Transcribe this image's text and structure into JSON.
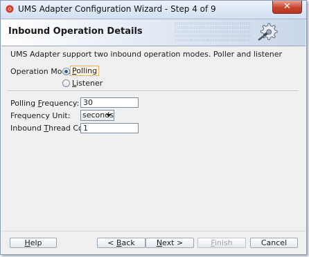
{
  "window": {
    "title": "UMS Adapter Configuration Wizard - Step 4 of 9",
    "close_label": "✕"
  },
  "header": {
    "title": "Inbound Operation Details"
  },
  "description": "UMS Adapter support two inbound operation modes. Poller and listener",
  "operation_mode": {
    "label": "Operation Mode:",
    "options": [
      {
        "label_prefix": "",
        "mnemonic": "P",
        "label_rest": "olling",
        "selected": true
      },
      {
        "label_prefix": "",
        "mnemonic": "L",
        "label_rest": "istener",
        "selected": false
      }
    ]
  },
  "fields": {
    "polling_frequency": {
      "label_prefix": "Polling ",
      "mnemonic": "F",
      "label_rest": "requency:",
      "value": "30"
    },
    "frequency_unit": {
      "label": "Frequency Unit:",
      "value": "seconds"
    },
    "inbound_thread_count": {
      "label_prefix": "Inbound ",
      "mnemonic": "T",
      "label_rest": "hread Count:",
      "value": "1"
    }
  },
  "buttons": {
    "help": {
      "prefix": "",
      "mnemonic": "H",
      "rest": "elp"
    },
    "back": {
      "prefix": "< ",
      "mnemonic": "B",
      "rest": "ack"
    },
    "next": {
      "prefix": "",
      "mnemonic": "N",
      "rest": "ext >"
    },
    "finish": {
      "prefix": "",
      "mnemonic": "F",
      "rest": "inish",
      "enabled": false
    },
    "cancel": {
      "label": "Cancel"
    }
  },
  "icons": {
    "app": "oracle-app-icon",
    "header": "gear-plug-icon"
  },
  "colors": {
    "title_bar": "#d3e0f2",
    "close_button": "#c7452e",
    "header_gradient_end": "#c9d7ea",
    "radio_selected": "#2a5fa8"
  }
}
